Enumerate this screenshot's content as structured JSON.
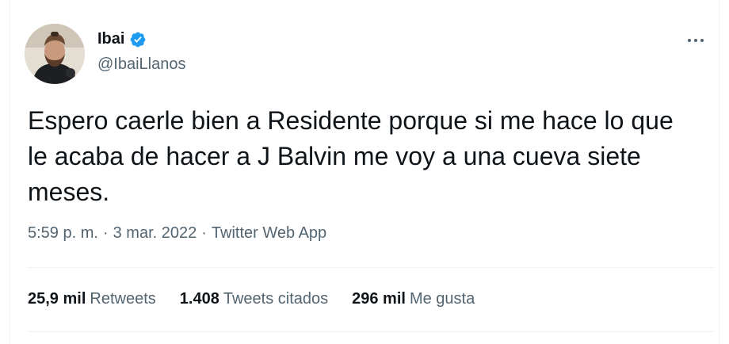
{
  "author": {
    "name": "Ibai",
    "handle": "@IbaiLlanos",
    "verified": true,
    "verified_color": "#1d9bf0",
    "avatar_icon": "profile-avatar"
  },
  "tweet": {
    "text": "Espero caerle bien a Residente porque si me hace lo que le acaba de hacer a J Balvin me voy a una cueva siete meses.",
    "time": "5:59 p. m.",
    "date": "3 mar. 2022",
    "source": "Twitter Web App",
    "separator": "·"
  },
  "stats": [
    {
      "value": "25,9 mil",
      "label": "Retweets"
    },
    {
      "value": "1.408",
      "label": "Tweets citados"
    },
    {
      "value": "296 mil",
      "label": "Me gusta"
    }
  ],
  "colors": {
    "text": "#0f1419",
    "secondary": "#536471",
    "border": "#eff3f4"
  }
}
